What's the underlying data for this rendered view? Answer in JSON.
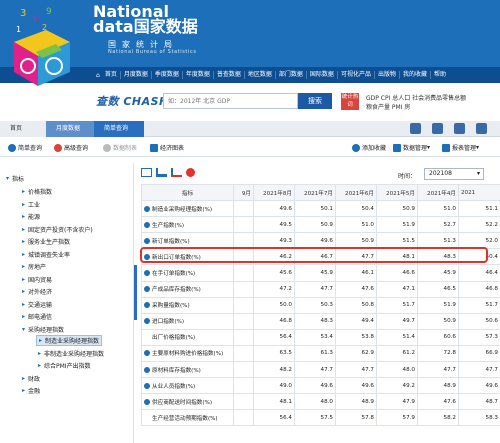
{
  "header": {
    "brand_line1": "National",
    "brand_line2": "data国家数据",
    "brand_cn": "国家统计局",
    "brand_en": "National Bureau of Statistics"
  },
  "nav": [
    "首页",
    "月度数据",
    "季度数据",
    "年度数据",
    "普查数据",
    "地区数据",
    "部门数据",
    "国际数据",
    "可视化产品",
    "出版物",
    "我的收藏",
    "帮助"
  ],
  "search": {
    "logo_text": "查数 CHASHU",
    "placeholder": "如：2012年 北京 GDP",
    "button": "搜索",
    "hot_label": "统计热词",
    "hot_links_1": "GDP  CPI  总人口  社会消费品零售总额",
    "hot_links_2": "粮食产量  PMI  房"
  },
  "breadcrumb": {
    "home": "首页",
    "month": "月度数据",
    "query": "简单查询"
  },
  "toolbar": {
    "simple_query": "简单查询",
    "advanced_query": "高级查询",
    "table_make": "数据制表",
    "chart_make": "经济图表",
    "add_favorite": "添加收藏",
    "data_manage": "数据管理",
    "report_manage": "报表管理"
  },
  "sidebar": {
    "root": "指标",
    "items": [
      "价格指数",
      "工业",
      "能源",
      "固定资产投资(不含农户)",
      "服务业生产指数",
      "城镇调查失业率",
      "房地产",
      "国内贸易",
      "对外经济",
      "交通运输",
      "邮电通信",
      "采购经理指数"
    ],
    "sub_items": [
      "制造业采购经理指数",
      "非制造业采购经理指数",
      "综合PMI产出指数"
    ],
    "tail_items": [
      "财政",
      "金融"
    ]
  },
  "time": {
    "label": "时间：",
    "value": "202108"
  },
  "table": {
    "headers": [
      "指标",
      "9月",
      "2021年8月",
      "2021年7月",
      "2021年6月",
      "2021年5月",
      "2021年4月",
      "2021"
    ],
    "rows": [
      {
        "name": "制造业采购经理指数(%)",
        "icon": true,
        "values": [
          "49.6",
          "50.1",
          "50.4",
          "50.9",
          "51.0",
          "51.1"
        ]
      },
      {
        "name": "生产指数(%)",
        "icon": true,
        "values": [
          "49.5",
          "50.9",
          "51.0",
          "51.9",
          "52.7",
          "52.2"
        ]
      },
      {
        "name": "新订单指数(%)",
        "icon": true,
        "values": [
          "49.3",
          "49.6",
          "50.9",
          "51.5",
          "51.3",
          "52.0"
        ]
      },
      {
        "name": "新出口订单指数(%)",
        "icon": true,
        "values": [
          "46.2",
          "46.7",
          "47.7",
          "48.1",
          "48.3",
          "50.4"
        ]
      },
      {
        "name": "在手订单指数(%)",
        "icon": true,
        "values": [
          "45.6",
          "45.9",
          "46.1",
          "46.6",
          "45.9",
          "46.4"
        ]
      },
      {
        "name": "产成品库存指数(%)",
        "icon": true,
        "values": [
          "47.2",
          "47.7",
          "47.6",
          "47.1",
          "46.5",
          "46.8"
        ]
      },
      {
        "name": "采购量指数(%)",
        "icon": true,
        "values": [
          "50.0",
          "50.3",
          "50.8",
          "51.7",
          "51.9",
          "51.7"
        ]
      },
      {
        "name": "进口指数(%)",
        "icon": true,
        "values": [
          "46.8",
          "48.3",
          "49.4",
          "49.7",
          "50.9",
          "50.6"
        ]
      },
      {
        "name": "出厂价格指数(%)",
        "icon": false,
        "values": [
          "56.4",
          "53.4",
          "53.8",
          "51.4",
          "60.6",
          "57.3"
        ]
      },
      {
        "name": "主要原材料购进价格指数(%)",
        "icon": true,
        "values": [
          "63.5",
          "61.3",
          "62.9",
          "61.2",
          "72.8",
          "66.9"
        ]
      },
      {
        "name": "原材料库存指数(%)",
        "icon": true,
        "values": [
          "48.2",
          "47.7",
          "47.7",
          "48.0",
          "47.7",
          "47.7"
        ]
      },
      {
        "name": "从业人员指数(%)",
        "icon": true,
        "values": [
          "49.0",
          "49.6",
          "49.6",
          "49.2",
          "48.9",
          "49.6"
        ]
      },
      {
        "name": "供应商配送时间指数(%)",
        "icon": true,
        "values": [
          "48.1",
          "48.0",
          "48.9",
          "47.9",
          "47.6",
          "48.7"
        ]
      },
      {
        "name": "生产经营活动预期指数(%)",
        "icon": false,
        "values": [
          "56.4",
          "57.5",
          "57.8",
          "57.9",
          "58.2",
          "58.3"
        ]
      }
    ]
  },
  "colors": {
    "banner": "#1c6fb8",
    "nav": "#0d4e92",
    "highlight": "#e0322b"
  }
}
